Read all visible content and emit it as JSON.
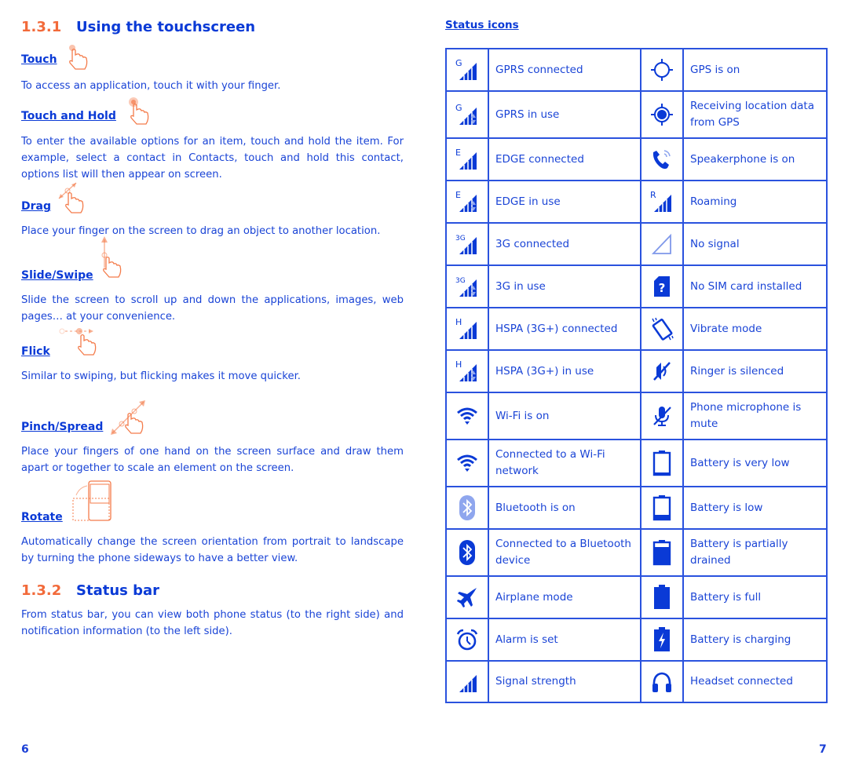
{
  "left_page": {
    "section1": {
      "number": "1.3.1",
      "title": "Using the touchscreen"
    },
    "gestures": [
      {
        "name": "Touch",
        "icon": "touch-gesture-icon",
        "text": "To access an application, touch it with your finger."
      },
      {
        "name": "Touch and Hold",
        "icon": "touch-hold-gesture-icon",
        "text": "To enter the available options for an item, touch and hold the item. For example, select a contact in Contacts, touch and hold this contact, options list will then appear on screen."
      },
      {
        "name": "Drag",
        "icon": "drag-gesture-icon",
        "text": "Place your finger on the screen to drag an object to another location."
      },
      {
        "name": "Slide/Swipe",
        "icon": "swipe-gesture-icon",
        "text": "Slide the screen to scroll up and down the applications, images, web pages… at your convenience."
      },
      {
        "name": "Flick",
        "icon": "flick-gesture-icon",
        "text": "Similar to swiping, but flicking makes it move quicker."
      },
      {
        "name": "Pinch/Spread",
        "icon": "pinch-gesture-icon",
        "text": "Place your fingers of one hand on the screen surface and draw them apart or together to scale an element on the screen."
      },
      {
        "name": "Rotate",
        "icon": "rotate-gesture-icon",
        "text": "Automatically change the screen orientation from portrait to landscape by turning the phone sideways to have a better view."
      }
    ],
    "section2": {
      "number": "1.3.2",
      "title": "Status bar",
      "text": "From status bar, you can view both phone status (to the right side) and notification information (to the left side)."
    },
    "page_number": "6"
  },
  "right_page": {
    "heading": "Status icons",
    "rows": [
      [
        {
          "icon": "gprs-connected-icon",
          "label": "GPRS connected"
        },
        {
          "icon": "gps-on-icon",
          "label": "GPS is on"
        }
      ],
      [
        {
          "icon": "gprs-in-use-icon",
          "label": "GPRS in use"
        },
        {
          "icon": "gps-receiving-icon",
          "label": "Receiving location data from GPS"
        }
      ],
      [
        {
          "icon": "edge-connected-icon",
          "label": "EDGE connected"
        },
        {
          "icon": "speakerphone-icon",
          "label": "Speakerphone is on"
        }
      ],
      [
        {
          "icon": "edge-in-use-icon",
          "label": "EDGE in use"
        },
        {
          "icon": "roaming-icon",
          "label": "Roaming"
        }
      ],
      [
        {
          "icon": "3g-connected-icon",
          "label": "3G connected"
        },
        {
          "icon": "no-signal-icon",
          "label": "No signal"
        }
      ],
      [
        {
          "icon": "3g-in-use-icon",
          "label": "3G in use"
        },
        {
          "icon": "no-sim-icon",
          "label": "No SIM card installed"
        }
      ],
      [
        {
          "icon": "hspa-connected-icon",
          "label": "HSPA (3G+) connected"
        },
        {
          "icon": "vibrate-icon",
          "label": "Vibrate mode"
        }
      ],
      [
        {
          "icon": "hspa-in-use-icon",
          "label": "HSPA (3G+) in use"
        },
        {
          "icon": "ringer-silenced-icon",
          "label": "Ringer is silenced"
        }
      ],
      [
        {
          "icon": "wifi-on-icon",
          "label": "Wi-Fi is on"
        },
        {
          "icon": "mic-mute-icon",
          "label": "Phone microphone is mute"
        }
      ],
      [
        {
          "icon": "wifi-connected-icon",
          "label": "Connected to a Wi-Fi network"
        },
        {
          "icon": "battery-very-low-icon",
          "label": "Battery is very low"
        }
      ],
      [
        {
          "icon": "bluetooth-on-icon",
          "label": "Bluetooth is on"
        },
        {
          "icon": "battery-low-icon",
          "label": "Battery is low"
        }
      ],
      [
        {
          "icon": "bluetooth-connected-icon",
          "label": "Connected to a Bluetooth device"
        },
        {
          "icon": "battery-partial-icon",
          "label": "Battery is partially drained"
        }
      ],
      [
        {
          "icon": "airplane-icon",
          "label": "Airplane mode"
        },
        {
          "icon": "battery-full-icon",
          "label": "Battery is full"
        }
      ],
      [
        {
          "icon": "alarm-icon",
          "label": "Alarm is set"
        },
        {
          "icon": "battery-charging-icon",
          "label": "Battery is charging"
        }
      ],
      [
        {
          "icon": "signal-strength-icon",
          "label": "Signal strength"
        },
        {
          "icon": "headset-icon",
          "label": "Headset connected"
        }
      ]
    ],
    "page_number": "7"
  },
  "colors": {
    "text_blue": "#1a44d6",
    "heading_blue": "#0a3ad6",
    "accent_orange": "#f26a3a",
    "table_border": "#2a52de"
  }
}
